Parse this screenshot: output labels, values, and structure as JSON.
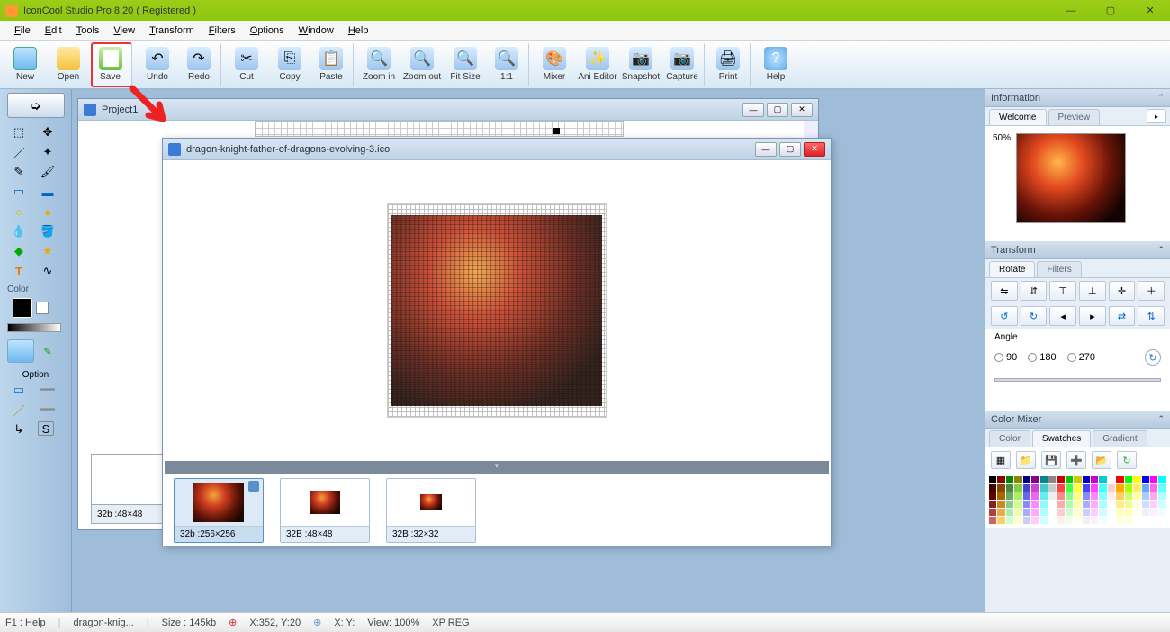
{
  "title": "IconCool Studio Pro 8.20 ( Registered )",
  "menu": [
    "File",
    "Edit",
    "Tools",
    "View",
    "Transform",
    "Filters",
    "Options",
    "Window",
    "Help"
  ],
  "toolbar": [
    {
      "name": "new",
      "label": "New"
    },
    {
      "name": "open",
      "label": "Open"
    },
    {
      "name": "save",
      "label": "Save",
      "hl": true
    },
    {
      "name": "undo",
      "label": "Undo"
    },
    {
      "name": "redo",
      "label": "Redo"
    },
    {
      "name": "cut",
      "label": "Cut"
    },
    {
      "name": "copy",
      "label": "Copy"
    },
    {
      "name": "paste",
      "label": "Paste"
    },
    {
      "name": "zoomin",
      "label": "Zoom in"
    },
    {
      "name": "zoomout",
      "label": "Zoom out"
    },
    {
      "name": "fitsize",
      "label": "Fit Size"
    },
    {
      "name": "oneone",
      "label": "1:1"
    },
    {
      "name": "mixer",
      "label": "Mixer"
    },
    {
      "name": "anieditor",
      "label": "Ani Editor"
    },
    {
      "name": "snapshot",
      "label": "Snapshot"
    },
    {
      "name": "capture",
      "label": "Capture"
    },
    {
      "name": "print",
      "label": "Print"
    },
    {
      "name": "help",
      "label": "Help"
    }
  ],
  "left": {
    "color": "Color",
    "option": "Option"
  },
  "windows": {
    "project1": {
      "title": "Project1",
      "thumb": "32b :48×48"
    },
    "dragon": {
      "title": "dragon-knight-father-of-dragons-evolving-3.ico",
      "thumbs": [
        {
          "label": "32b :256×256",
          "size": 56,
          "active": true
        },
        {
          "label": "32B :48×48",
          "size": 34
        },
        {
          "label": "32B :32×32",
          "size": 24
        }
      ]
    }
  },
  "panels": {
    "information": "Information",
    "info_tabs": [
      "Welcome",
      "Preview"
    ],
    "preview_pct": "50%",
    "transform": "Transform",
    "trans_tabs": [
      "Rotate",
      "Filters"
    ],
    "angle": "Angle",
    "angles": [
      "90",
      "180",
      "270"
    ],
    "colormixer": "Color Mixer",
    "cm_tabs": [
      "Color",
      "Swatches",
      "Gradient"
    ]
  },
  "status": {
    "help": "F1 : Help",
    "file": "dragon-knig...",
    "size": "Size : 145kb",
    "xy": "X:352, Y:20",
    "xy2": "X: Y:",
    "view": "View: 100%",
    "reg": "XP REG"
  },
  "swatch_rows": [
    [
      "#000",
      "#800",
      "#080",
      "#880",
      "#008",
      "#808",
      "#088",
      "#888",
      "#c00",
      "#0c0",
      "#cc0",
      "#00c",
      "#c0c",
      "#0cc",
      "#fff",
      "#f00",
      "#0f0",
      "#ff0",
      "#00f",
      "#f0f",
      "#0ff"
    ],
    [
      "#400",
      "#840",
      "#484",
      "#8c4",
      "#44c",
      "#c4c",
      "#4cc",
      "#ccc",
      "#f44",
      "#4f4",
      "#ff4",
      "#44f",
      "#f4f",
      "#4ff",
      "#fcc",
      "#fa0",
      "#af0",
      "#fe6",
      "#6af",
      "#f6e",
      "#6ff"
    ],
    [
      "#600",
      "#a60",
      "#6a6",
      "#ae6",
      "#66e",
      "#e6e",
      "#6ee",
      "#eee",
      "#f88",
      "#8f8",
      "#ff8",
      "#88f",
      "#f8f",
      "#8ff",
      "#fee",
      "#fc6",
      "#cf6",
      "#ffa",
      "#acf",
      "#fae",
      "#aff"
    ],
    [
      "#822",
      "#c82",
      "#8c8",
      "#cf8",
      "#88f",
      "#f8f",
      "#8ff",
      "#fff",
      "#faa",
      "#afa",
      "#ffa",
      "#aaf",
      "#faf",
      "#aff",
      "#fff",
      "#fe8",
      "#ef8",
      "#ffd",
      "#cdf",
      "#fcf",
      "#cff"
    ],
    [
      "#a44",
      "#ea4",
      "#aea",
      "#efa",
      "#aaf",
      "#faf",
      "#aff",
      "#fff",
      "#fcc",
      "#cfc",
      "#ffc",
      "#ccf",
      "#fcf",
      "#cff",
      "#fff",
      "#ffb",
      "#ffb",
      "#ffe",
      "#eef",
      "#fef",
      "#eff"
    ],
    [
      "#c66",
      "#fc6",
      "#cfc",
      "#ffc",
      "#ccf",
      "#fcf",
      "#cff",
      "#fff",
      "#fee",
      "#efe",
      "#ffe",
      "#eef",
      "#fef",
      "#eff",
      "#fff",
      "#ffd",
      "#ffd",
      "#fff",
      "#fff",
      "#fff",
      "#fff"
    ]
  ]
}
